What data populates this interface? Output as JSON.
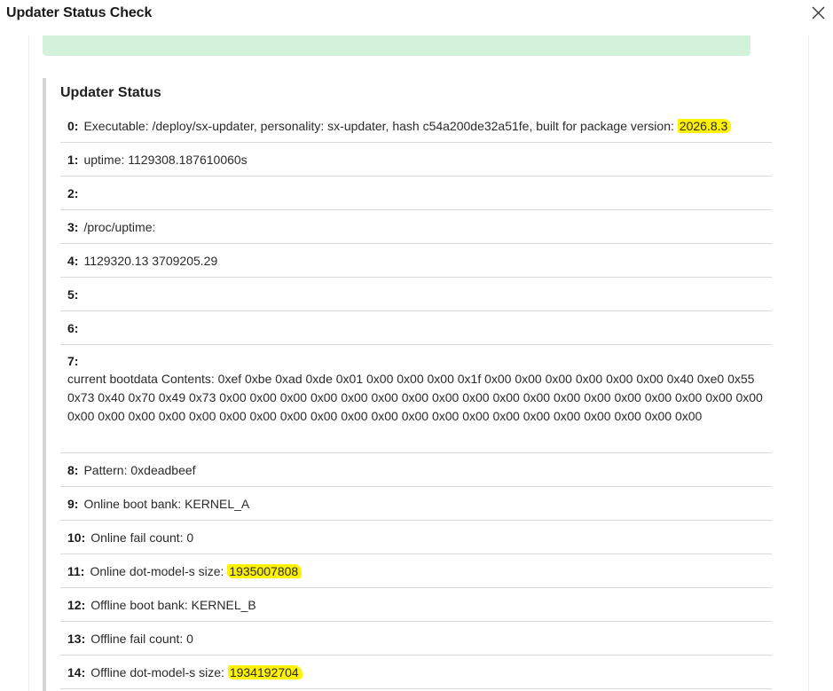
{
  "dialog": {
    "title": "Updater Status Check",
    "close_icon": "close-icon"
  },
  "status": {
    "heading": "Updater Status",
    "rows": [
      {
        "index": "0:",
        "text": "Executable: /deploy/sx-updater, personality: sx-updater, hash c54a200de32a51fe, built for package version: ",
        "highlight": "2026.8.3"
      },
      {
        "index": "1:",
        "text": "uptime: 1129308.187610060s"
      },
      {
        "index": "2:",
        "text": ""
      },
      {
        "index": "3:",
        "text": "/proc/uptime:"
      },
      {
        "index": "4:",
        "text": "1129320.13 3709205.29"
      },
      {
        "index": "5:",
        "text": ""
      },
      {
        "index": "6:",
        "text": ""
      },
      {
        "index": "7:",
        "text": "current bootdata Contents: 0xef 0xbe 0xad 0xde 0x01 0x00 0x00 0x00 0x1f 0x00 0x00 0x00 0x00 0x00 0x00 0x40 0xe0 0x55 0x73 0x40 0x70 0x49 0x73 0x00 0x00 0x00 0x00 0x00 0x00 0x00 0x00 0x00 0x00 0x00 0x00 0x00 0x00 0x00 0x00 0x00 0x00 0x00 0x00 0x00 0x00 0x00 0x00 0x00 0x00 0x00 0x00 0x00 0x00 0x00 0x00 0x00 0x00 0x00 0x00 0x00 0x00 0x00"
      },
      {
        "index": "8:",
        "text": "Pattern: 0xdeadbeef"
      },
      {
        "index": "9:",
        "text": "Online boot bank: KERNEL_A"
      },
      {
        "index": "10:",
        "text": "Online fail count: 0"
      },
      {
        "index": "11:",
        "text": "Online dot-model-s size: ",
        "highlight": "1935007808"
      },
      {
        "index": "12:",
        "text": "Offline boot bank: KERNEL_B"
      },
      {
        "index": "13:",
        "text": "Offline fail count: 0"
      },
      {
        "index": "14:",
        "text": "Offline dot-model-s size: ",
        "highlight": "1934192704"
      }
    ]
  },
  "colors": {
    "banner": "#d3f2dc",
    "highlight": "#fff200",
    "divider": "#d9d9d9"
  }
}
